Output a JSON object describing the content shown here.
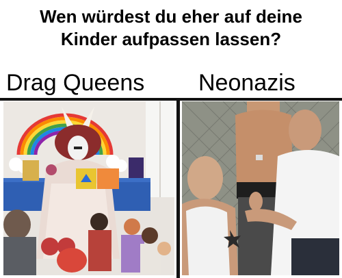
{
  "meme": {
    "title_line1": "Wen würdest du eher auf deine",
    "title_line2": "Kinder aufpassen lassen?",
    "left_label": "Drag Queens",
    "right_label": "Neonazis"
  },
  "colors": {
    "text": "#000000",
    "divider": "#111111",
    "background": "#ffffff"
  }
}
